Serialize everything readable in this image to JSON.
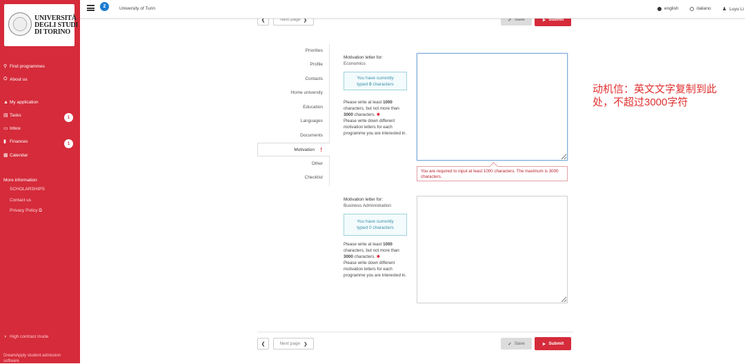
{
  "app": {
    "logo_lines": [
      "UNIVERSITÀ",
      "DEGLI STUDI",
      "DI TORINO"
    ],
    "tasks_badge": "2",
    "title": "University of Turin"
  },
  "header": {
    "lang_english": "english",
    "lang_italiano": "italiano",
    "user_name": "Luyu Li"
  },
  "sidebar": {
    "find_programmes": "Find programmes",
    "about_us": "About us",
    "my_application": "My application",
    "tasks": "Tasks",
    "tasks_count": "1",
    "inbox": "Inbox",
    "finances": "Finances",
    "finances_count": "1",
    "calendar": "Calendar",
    "more_information": "More information",
    "scholarships": "SCHOLARSHIPS",
    "contact_us": "Contact us",
    "privacy_policy": "Privacy Policy",
    "high_contrast": "High contrast mode",
    "footer_line1": "DreamApply student admission",
    "footer_line2": "software"
  },
  "tabs": {
    "priorities": "Priorities",
    "profile": "Profile",
    "contacts": "Contacts",
    "home_university": "Home university",
    "education": "Education",
    "languages": "Languages",
    "documents": "Documents",
    "motivation": "Motivation",
    "other": "Other",
    "checklist": "Checklist"
  },
  "letters": [
    {
      "label": "Motivation letter for:",
      "programme": "Economics",
      "counter_line1": "You have currently",
      "counter_prefix": "typed",
      "counter_value": "0",
      "counter_suffix": "characters",
      "instr_1": "Please write at least",
      "min_chars": "1000",
      "instr_2": "characters, but not more than",
      "max_chars": "3000",
      "instr_3": "characters.",
      "instr_4": "Please write down different motivation letters for each programme you are interested in.",
      "value": ""
    },
    {
      "label": "Motivation letter for:",
      "programme": "Business Administration",
      "counter_line1": "You have currently",
      "counter_prefix": "typed",
      "counter_value": "0",
      "counter_suffix": "characters",
      "instr_1": "Please write at least",
      "min_chars": "1000",
      "instr_2": "characters, but not more than",
      "max_chars": "3000",
      "instr_3": "characters.",
      "instr_4": "Please write down different motivation letters for each programme you are interested in.",
      "value": ""
    }
  ],
  "error_message": "You are required to input at least 1000 characters. The maximum is 3000 characters.",
  "annotation": "动机信：英文文字复制到此处，不超过3000字符",
  "buttons": {
    "next_page": "Next page",
    "save": "Save",
    "submit": "Submit"
  },
  "colors": {
    "brand_red": "#d52b3a",
    "badge_blue": "#1a7bd1",
    "annotation_red": "#e03030"
  }
}
